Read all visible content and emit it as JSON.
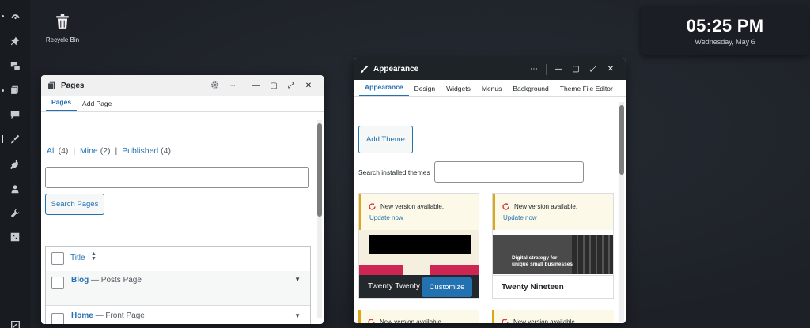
{
  "desktop": {
    "recycle_bin_label": "Recycle Bin"
  },
  "clock": {
    "time": "05:25 PM",
    "date": "Wednesday, May 6"
  },
  "pages_window": {
    "title": "Pages",
    "controls": [
      "⋯",
      "—",
      "▢",
      "⤢",
      "✕"
    ],
    "tabs": [
      "Pages",
      "Add Page"
    ],
    "filters": {
      "all": "All",
      "all_count": "(4)",
      "mine": "Mine",
      "mine_count": "(2)",
      "published": "Published",
      "published_count": "(4)",
      "sep": "|"
    },
    "search_button": "Search Pages",
    "table": {
      "title_col": "Title",
      "rows": [
        {
          "title": "Blog",
          "suffix": "— Posts Page"
        },
        {
          "title": "Home",
          "suffix": "— Front Page"
        }
      ]
    }
  },
  "appearance_window": {
    "title": "Appearance",
    "controls": [
      "⋯",
      "—",
      "▢",
      "⤢",
      "✕"
    ],
    "tabs": [
      "Appearance",
      "Design",
      "Widgets",
      "Menus",
      "Background",
      "Theme File Editor"
    ],
    "add_theme_button": "Add Theme",
    "search_label": "Search installed themes",
    "notice_text": "New version available.",
    "update_link": "Update now",
    "themes": [
      {
        "name": "Twenty Twenty",
        "action": "Customize"
      },
      {
        "name": "Twenty Nineteen",
        "tagline_1": "Digital strategy for",
        "tagline_2": "unique small businesses"
      }
    ]
  },
  "colors": {
    "accent": "#2271b1",
    "notice_border": "#dba617",
    "notice_bg": "#fcf9e8",
    "update_icon": "#d63638"
  }
}
